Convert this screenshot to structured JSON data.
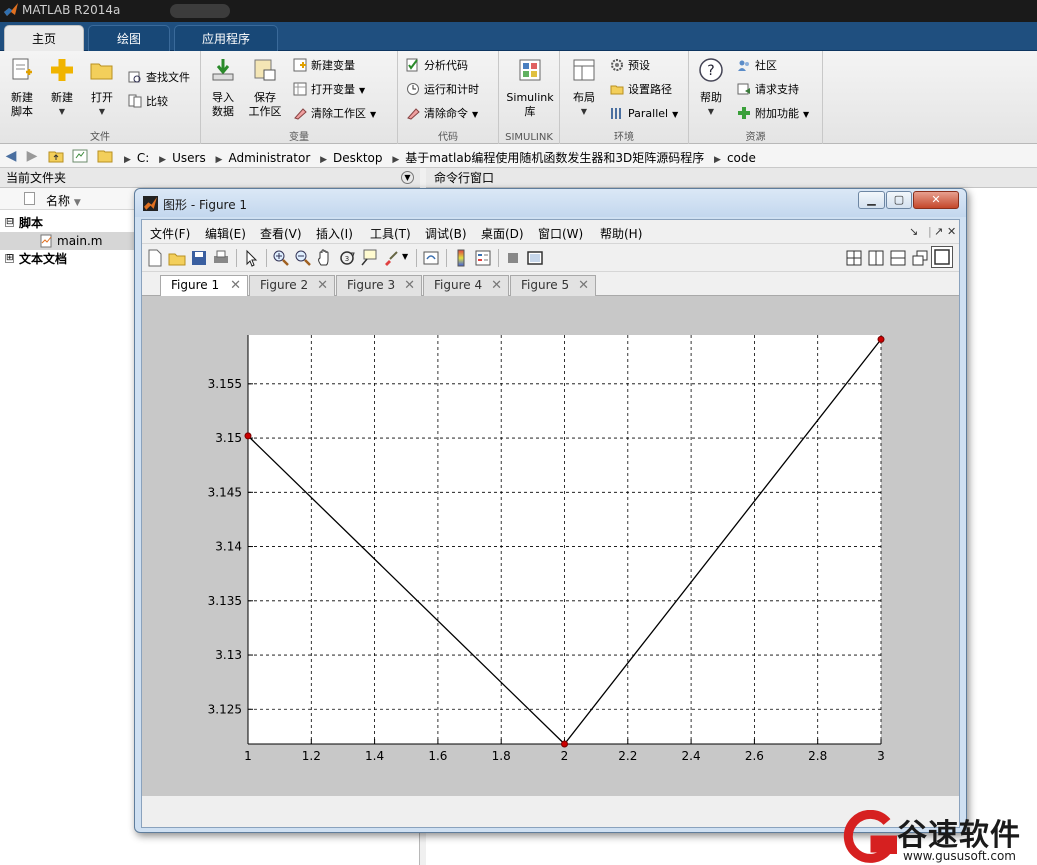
{
  "app": {
    "title": "MATLAB R2014a"
  },
  "ribbon_tabs": [
    {
      "label": "主页",
      "active": true
    },
    {
      "label": "绘图",
      "active": false
    },
    {
      "label": "应用程序",
      "active": false
    }
  ],
  "ribbon": {
    "groups": {
      "file": "文件",
      "variable": "变量",
      "code": "代码",
      "simulink": "SIMULINK",
      "environment": "环境",
      "resources": "资源"
    },
    "new_script": [
      "新建",
      "脚本"
    ],
    "new": "新建",
    "open": "打开",
    "find_files": "查找文件",
    "compare": "比较",
    "import_data": [
      "导入",
      "数据"
    ],
    "save_workspace": [
      "保存",
      "工作区"
    ],
    "new_variable": "新建变量",
    "open_variable": "打开变量",
    "clear_workspace": "清除工作区",
    "analyze_code": "分析代码",
    "run_and_time": "运行和计时",
    "clear_commands": "清除命令",
    "simulink_library": [
      "Simulink",
      "库"
    ],
    "layout": "布局",
    "preferences": "预设",
    "set_path": "设置路径",
    "parallel": "Parallel",
    "help": "帮助",
    "community": "社区",
    "request_support": "请求支持",
    "add_ons": "附加功能"
  },
  "address": {
    "crumbs": [
      "C:",
      "Users",
      "Administrator",
      "Desktop",
      "基于matlab编程使用随机函数发生器和3D矩阵源码程序",
      "code"
    ]
  },
  "current_folder": {
    "title": "当前文件夹",
    "column_name": "名称",
    "groups": [
      {
        "label": "脚本",
        "expand": "⊟",
        "files": [
          "main.m"
        ]
      },
      {
        "label": "文本文档",
        "expand": "⊞",
        "files": []
      }
    ]
  },
  "command_window": {
    "title": "命令行窗口"
  },
  "figure_window": {
    "title": "图形 - Figure 1",
    "menu": [
      "文件(F)",
      "编辑(E)",
      "查看(V)",
      "插入(I)",
      "工具(T)",
      "调试(B)",
      "桌面(D)",
      "窗口(W)",
      "帮助(H)"
    ],
    "tabs": [
      "Figure 1",
      "Figure 2",
      "Figure 3",
      "Figure 4",
      "Figure 5"
    ],
    "active_tab": "Figure 1"
  },
  "chart_data": {
    "type": "line",
    "x": [
      1,
      2,
      3
    ],
    "series": [
      {
        "values": [
          3.1502,
          3.1218,
          3.1591
        ],
        "color": "#000000",
        "marker": "o",
        "marker_color": "#cc0000"
      }
    ],
    "xlim": [
      1,
      3
    ],
    "ylim": [
      3.1218,
      3.1595
    ],
    "xticks": [
      1,
      1.2,
      1.4,
      1.6,
      1.8,
      2,
      2.2,
      2.4,
      2.6,
      2.8,
      3
    ],
    "xtick_labels": [
      "1",
      "1.2",
      "1.4",
      "1.6",
      "1.8",
      "2",
      "2.2",
      "2.4",
      "2.6",
      "2.8",
      "3"
    ],
    "yticks": [
      3.125,
      3.13,
      3.135,
      3.14,
      3.145,
      3.15,
      3.155
    ],
    "ytick_labels": [
      "3.125",
      "3.13",
      "3.135",
      "3.14",
      "3.145",
      "3.15",
      "3.155"
    ],
    "grid": true,
    "title": "",
    "xlabel": "",
    "ylabel": ""
  },
  "watermark": {
    "name": "谷速软件",
    "url": "www.gususoft.com"
  }
}
